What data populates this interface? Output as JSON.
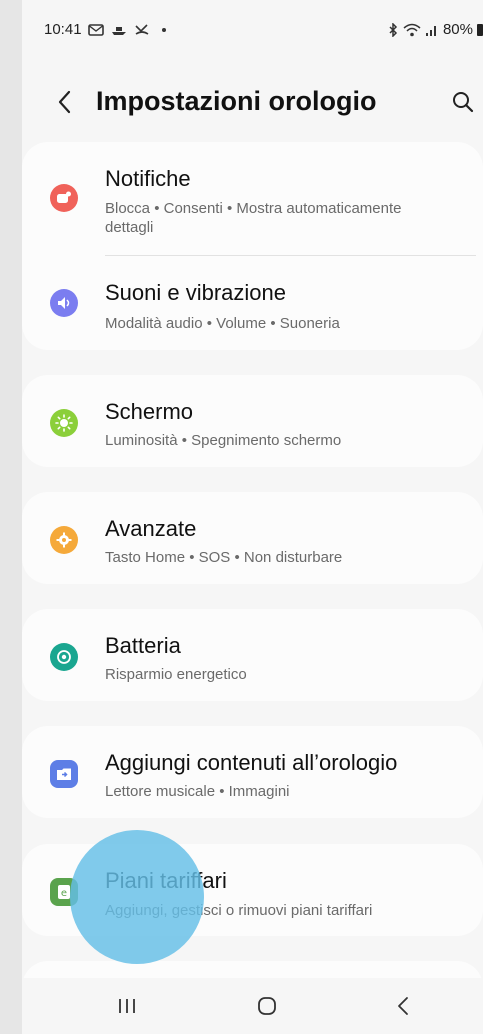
{
  "status_bar": {
    "time": "10:41",
    "battery": "80%",
    "notification_icons": [
      "mail-icon",
      "boat-icon",
      "missed-call-icon",
      "dot-icon"
    ],
    "system_icons": [
      "bluetooth-icon",
      "wifi-icon",
      "signal-icon",
      "battery-icon"
    ]
  },
  "header": {
    "title": "Impostazioni orologio",
    "back_icon": "chevron-left-icon",
    "search_icon": "search-icon"
  },
  "items": [
    {
      "title": "Notifiche",
      "subtitle": "Blocca • Consenti • Mostra automaticamente dettagli",
      "icon": "notification-icon",
      "color": "#f0625a"
    },
    {
      "title": "Suoni e vibrazione",
      "subtitle": "Modalità audio • Volume • Suoneria",
      "icon": "sound-icon",
      "color": "#7b7df0"
    },
    {
      "title": "Schermo",
      "subtitle": "Luminosità • Spegnimento schermo",
      "icon": "brightness-icon",
      "color": "#8bcf3a"
    },
    {
      "title": "Avanzate",
      "subtitle": "Tasto Home • SOS • Non disturbare",
      "icon": "gear-icon",
      "color": "#f5a93a"
    },
    {
      "title": "Batteria",
      "subtitle": "Risparmio energetico",
      "icon": "battery-care-icon",
      "color": "#1aa690"
    },
    {
      "title": "Aggiungi contenuti all’orologio",
      "subtitle": "Lettore musicale • Immagini",
      "icon": "add-content-icon",
      "color": "#5d7ee6"
    },
    {
      "title": "Piani tariffari",
      "subtitle": "Aggiungi, gestisci o rimuovi piani tariffari",
      "icon": "plan-icon",
      "color": "#5aa34d"
    }
  ],
  "nav_bar": {
    "recents_icon": "recents-icon",
    "home_icon": "home-icon",
    "back_icon": "back-icon"
  }
}
